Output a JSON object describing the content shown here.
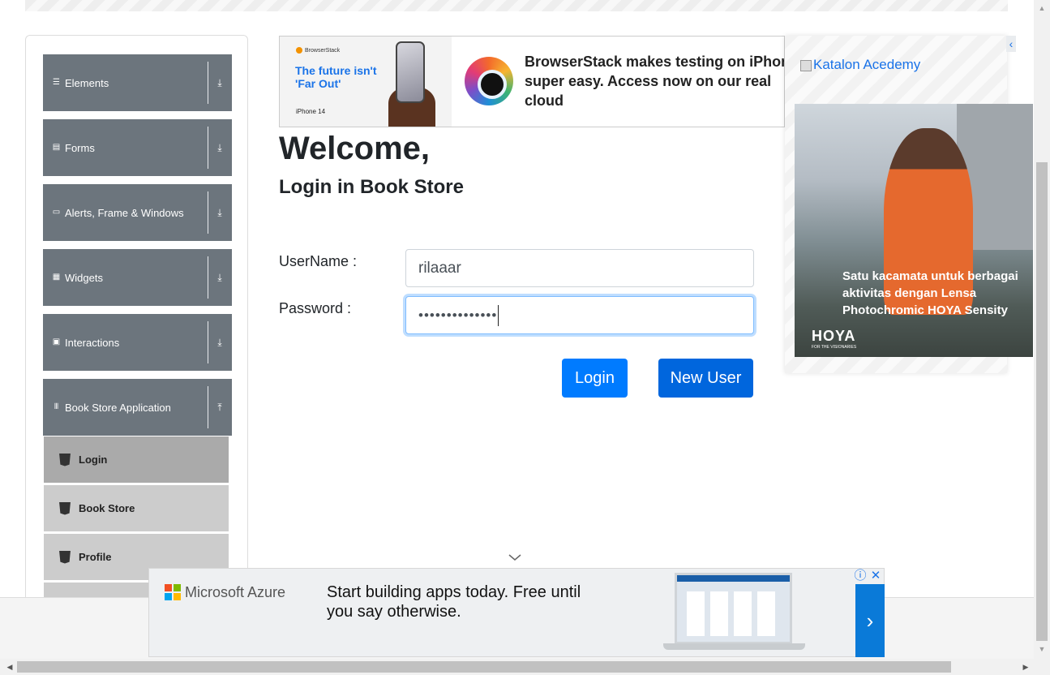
{
  "sidebar": {
    "groups": [
      {
        "label": "Elements",
        "icon": "hamburger-icon",
        "glyph": "☰",
        "arrow": "⤓"
      },
      {
        "label": "Forms",
        "icon": "form-icon",
        "glyph": "▤",
        "arrow": "⤓"
      },
      {
        "label": "Alerts, Frame & Windows",
        "icon": "window-icon",
        "glyph": "▭",
        "arrow": "⤓"
      },
      {
        "label": "Widgets",
        "icon": "grid-icon",
        "glyph": "▦",
        "arrow": "⤓"
      },
      {
        "label": "Interactions",
        "icon": "interaction-icon",
        "glyph": "▣",
        "arrow": "⤓"
      },
      {
        "label": "Book Store Application",
        "icon": "library-icon",
        "glyph": "𝍫",
        "arrow": "⤒"
      }
    ],
    "book_store_items": [
      "Login",
      "Book Store",
      "Profile"
    ]
  },
  "top_ad": {
    "brand": "BrowserStack",
    "tagline": "The future isn't 'Far Out'",
    "model": "iPhone 14",
    "message": "BrowserStack makes testing on iPhone super easy. Access now on our real cloud"
  },
  "login": {
    "heading": "Welcome,",
    "subheading": "Login in Book Store",
    "username_label": "UserName :",
    "password_label": "Password :",
    "username_value": "rilaaar",
    "password_value": "••••••••••••••",
    "login_button": "Login",
    "new_user_button": "New User"
  },
  "right_ad": {
    "link_text": "Katalon Acedemy",
    "copy_lines": [
      "Satu kacamata untuk berbagai",
      "aktivitas dengan Lensa",
      "Photochromic HOYA Sensity"
    ],
    "brand": "HOYA",
    "brand_sub": "FOR THE VISIONARIES"
  },
  "bottom_ad": {
    "brand": "Microsoft Azure",
    "message": "Start building apps today. Free until you say otherwise.",
    "next_arrow": "›",
    "info": "ⓘ",
    "close": "✕"
  },
  "colors": {
    "primary": "#007bff",
    "sidebar_group": "#6c757d",
    "submenu": "#cccccc",
    "submenu_active": "#aaaaaa"
  }
}
